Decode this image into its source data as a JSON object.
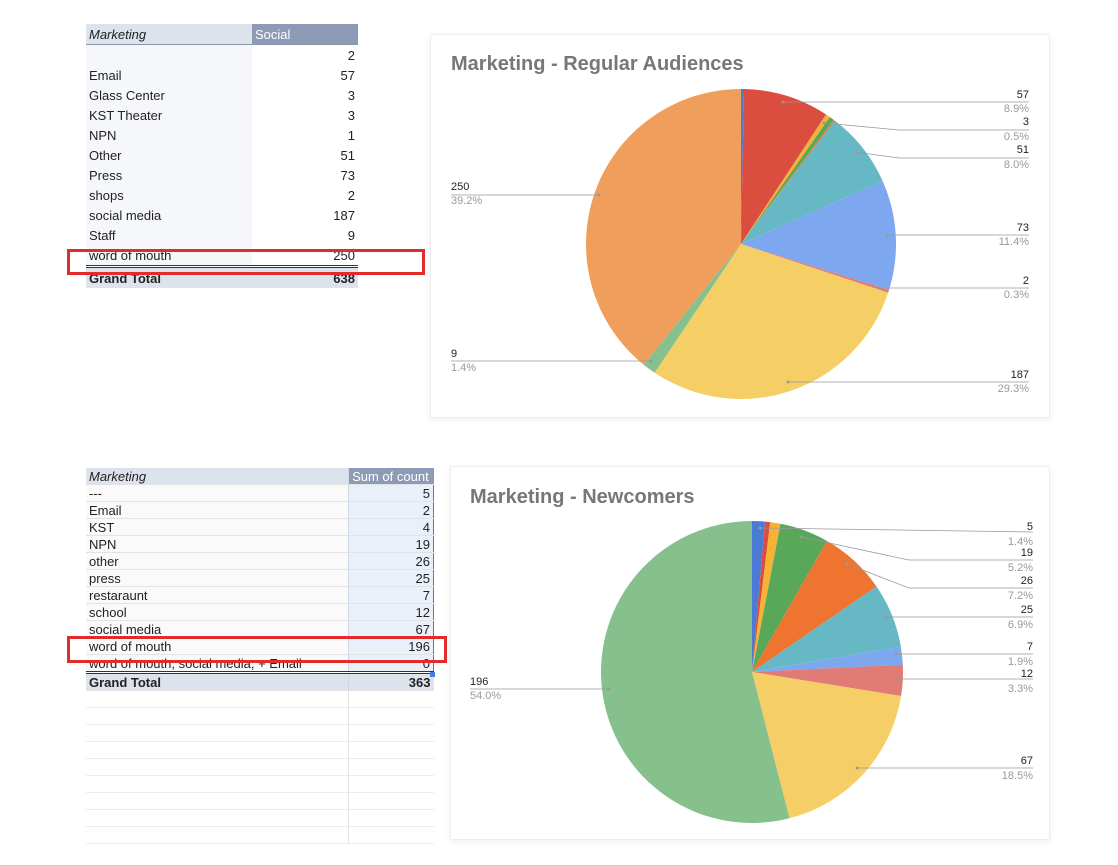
{
  "table1": {
    "header_label": "Marketing",
    "header_col": "Social",
    "rows": [
      {
        "label": "",
        "value": "2"
      },
      {
        "label": "Email",
        "value": "57"
      },
      {
        "label": "Glass Center",
        "value": "3"
      },
      {
        "label": "KST Theater",
        "value": "3"
      },
      {
        "label": "NPN",
        "value": "1"
      },
      {
        "label": "Other",
        "value": "51"
      },
      {
        "label": "Press",
        "value": "73"
      },
      {
        "label": "shops",
        "value": "2"
      },
      {
        "label": "social media",
        "value": "187"
      },
      {
        "label": "Staff",
        "value": "9"
      },
      {
        "label": "word of mouth",
        "value": "250"
      }
    ],
    "total_label": "Grand Total",
    "total_value": "638"
  },
  "table2": {
    "header_label": "Marketing",
    "header_col": "Sum of count",
    "rows": [
      {
        "label": "---",
        "value": "5"
      },
      {
        "label": "Email",
        "value": "2"
      },
      {
        "label": "KST",
        "value": "4"
      },
      {
        "label": "NPN",
        "value": "19"
      },
      {
        "label": "other",
        "value": "26"
      },
      {
        "label": "press",
        "value": "25"
      },
      {
        "label": "restaraunt",
        "value": "7"
      },
      {
        "label": "school",
        "value": "12"
      },
      {
        "label": "social media",
        "value": "67"
      },
      {
        "label": "word of mouth",
        "value": "196"
      },
      {
        "label": "word of mouth, social media, + Email",
        "value": "0"
      }
    ],
    "total_label": "Grand Total",
    "total_value": "363"
  },
  "chart_data": [
    {
      "type": "pie",
      "title": "Marketing - Regular Audiences",
      "slices": [
        {
          "value": 2,
          "pct": "0.3%",
          "color": "#4a7bd6"
        },
        {
          "value": 57,
          "pct": "8.9%",
          "color": "#db4d3f"
        },
        {
          "value": 3,
          "pct": "0.5%",
          "color": "#f5b335"
        },
        {
          "value": 3,
          "pct": "0.5%",
          "color": "#59a85a"
        },
        {
          "value": 1,
          "pct": "0.2%",
          "color": "#ef7430"
        },
        {
          "value": 51,
          "pct": "8.0%",
          "color": "#66b8c4"
        },
        {
          "value": 73,
          "pct": "11.4%",
          "color": "#7da7ee"
        },
        {
          "value": 2,
          "pct": "0.3%",
          "color": "#e07b75"
        },
        {
          "value": 187,
          "pct": "29.3%",
          "color": "#f5cf66"
        },
        {
          "value": 9,
          "pct": "1.4%",
          "color": "#86c08d"
        },
        {
          "value": 250,
          "pct": "39.2%",
          "color": "#f09e5c"
        }
      ],
      "labels": [
        {
          "value": "57",
          "pct": "8.9%"
        },
        {
          "value": "3",
          "pct": "0.5%"
        },
        {
          "value": "51",
          "pct": "8.0%"
        },
        {
          "value": "250",
          "pct": "39.2%"
        },
        {
          "value": "73",
          "pct": "11.4%"
        },
        {
          "value": "2",
          "pct": "0.3%"
        },
        {
          "value": "9",
          "pct": "1.4%"
        },
        {
          "value": "187",
          "pct": "29.3%"
        }
      ]
    },
    {
      "type": "pie",
      "title": "Marketing - Newcomers",
      "slices": [
        {
          "value": 5,
          "pct": "1.4%",
          "color": "#4a7bd6"
        },
        {
          "value": 2,
          "pct": "0.6%",
          "color": "#db4d3f"
        },
        {
          "value": 4,
          "pct": "1.1%",
          "color": "#f5b335"
        },
        {
          "value": 19,
          "pct": "5.2%",
          "color": "#59a85a"
        },
        {
          "value": 26,
          "pct": "7.2%",
          "color": "#ef7430"
        },
        {
          "value": 25,
          "pct": "6.9%",
          "color": "#66b8c4"
        },
        {
          "value": 7,
          "pct": "1.9%",
          "color": "#7da7ee"
        },
        {
          "value": 12,
          "pct": "3.3%",
          "color": "#e07b75"
        },
        {
          "value": 67,
          "pct": "18.5%",
          "color": "#f5cf66"
        },
        {
          "value": 196,
          "pct": "54.0%",
          "color": "#86c08d"
        }
      ],
      "labels": [
        {
          "value": "5",
          "pct": "1.4%"
        },
        {
          "value": "19",
          "pct": "5.2%"
        },
        {
          "value": "26",
          "pct": "7.2%"
        },
        {
          "value": "25",
          "pct": "6.9%"
        },
        {
          "value": "7",
          "pct": "1.9%"
        },
        {
          "value": "12",
          "pct": "3.3%"
        },
        {
          "value": "196",
          "pct": "54.0%"
        },
        {
          "value": "67",
          "pct": "18.5%"
        }
      ]
    }
  ]
}
